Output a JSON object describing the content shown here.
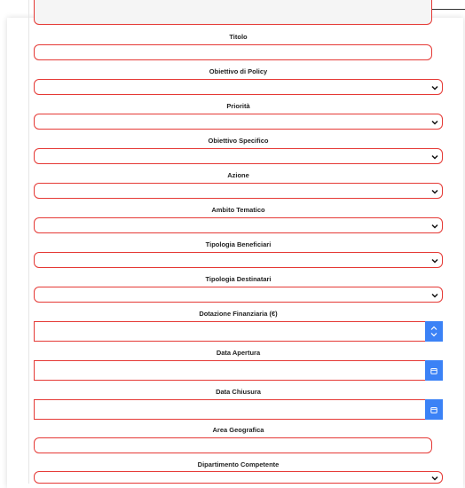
{
  "fields": {
    "titolo": {
      "label": "Titolo"
    },
    "obiettivo_policy": {
      "label": "Obiettivo di Policy"
    },
    "priorita": {
      "label": "Priorità"
    },
    "obiettivo_specifico": {
      "label": "Obiettivo Specifico"
    },
    "azione": {
      "label": "Azione"
    },
    "ambito_tematico": {
      "label": "Ambito Tematico"
    },
    "tipologia_beneficiari": {
      "label": "Tipologia Beneficiari"
    },
    "tipologia_destinatari": {
      "label": "Tipologia Destinatari"
    },
    "dotazione_finanziaria": {
      "label": "Dotazione Finanziaria (€)"
    },
    "data_apertura": {
      "label": "Data Apertura"
    },
    "data_chiusura": {
      "label": "Data Chiusura"
    },
    "area_geografica": {
      "label": "Area Geografica"
    },
    "dipartimento_competente": {
      "label": "Dipartimento Competente"
    }
  },
  "colors": {
    "border_error": "#e53935",
    "accent_button": "#3b82f6"
  },
  "icons": {
    "select_chevron": "chevron-down-icon",
    "stepper": "spin-arrows-icon",
    "calendar": "calendar-icon"
  }
}
